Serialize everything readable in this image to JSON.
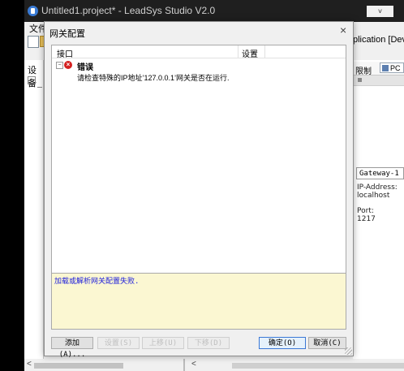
{
  "app": {
    "title": "Untitled1.project* - LeadSys Studio V2.0",
    "menu_file": "文件",
    "devices_tab": "设备",
    "bg_applic": "plication [Device",
    "right_tab1": "限制",
    "right_tab2": "PC",
    "gateway_value": "Gateway-1",
    "ip_label": "IP-Address:",
    "ip_value": "localhost",
    "port_label": "Port:",
    "port_value": "1217"
  },
  "dialog": {
    "title": "网关配置",
    "close_glyph": "×",
    "columns": {
      "interface": "接口",
      "settings": "设置"
    },
    "error_title": "错误",
    "error_message": "请检查特殊的IP地址’127.0.0.1’网关是否在运行.",
    "message": "加载或解析网关配置失败.",
    "buttons": {
      "add": "添加(A)...",
      "b2": "设置(S)",
      "b3": "上移(U)",
      "b4": "下移(D)",
      "ok": "确定(O)",
      "cancel": "取消(C)"
    }
  }
}
